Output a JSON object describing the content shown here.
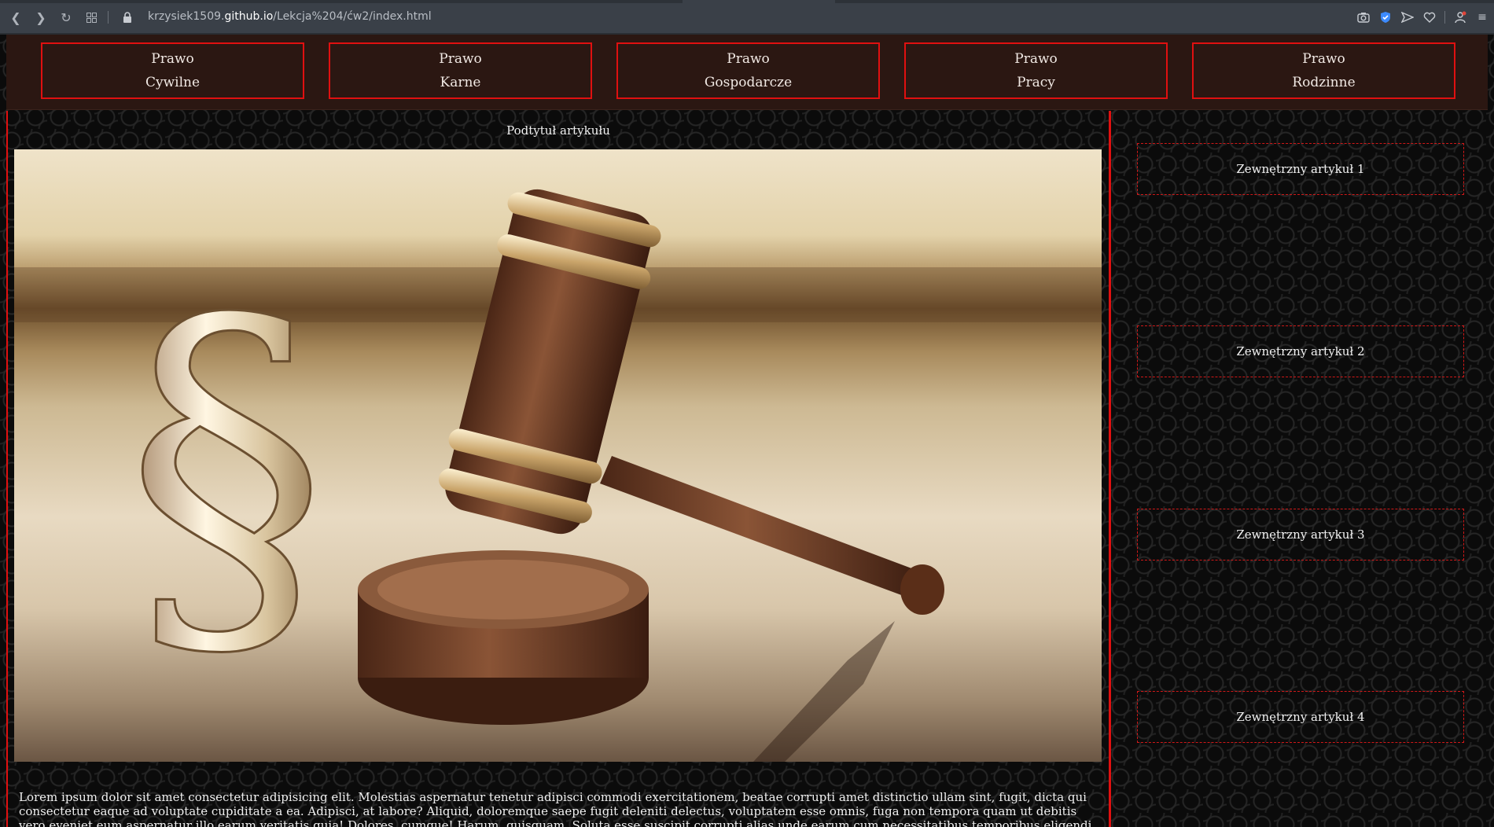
{
  "browser": {
    "url_prefix": "krzysiek1509.",
    "url_host": "github.io",
    "url_path": "/Lekcja%204/ćw2/index.html"
  },
  "nav": {
    "items": [
      {
        "line1": "Prawo",
        "line2": "Cywilne"
      },
      {
        "line1": "Prawo",
        "line2": "Karne"
      },
      {
        "line1": "Prawo",
        "line2": "Gospodarcze"
      },
      {
        "line1": "Prawo",
        "line2": "Pracy"
      },
      {
        "line1": "Prawo",
        "line2": "Rodzinne"
      }
    ]
  },
  "article": {
    "subtitle": "Podtytuł artykułu",
    "body": "Lorem ipsum dolor sit amet consectetur adipisicing elit. Molestias aspernatur tenetur adipisci commodi exercitationem, beatae corrupti amet distinctio ullam sint, fugit, dicta qui consectetur eaque ad voluptate cupiditate a ea. Adipisci, at labore? Aliquid, doloremque saepe fugit deleniti delectus, voluptatem esse omnis, fuga non tempora quam ut debitis vero eveniet eum aspernatur illo earum veritatis quia! Dolores, cumque! Harum, quisquam. Soluta esse suscipit corrupti alias unde earum cum necessitatibus temporibus eligendi nam similique perferendis, reprehenderit aliquam nostrum. Maiores inventore, fugiat molestiae nisi,"
  },
  "sidebar": {
    "links": [
      {
        "label": "Zewnętrzny artykuł 1"
      },
      {
        "label": "Zewnętrzny artykuł 2"
      },
      {
        "label": "Zewnętrzny artykuł 3"
      },
      {
        "label": "Zewnętrzny artykuł 4"
      }
    ]
  },
  "colors": {
    "accent_red": "#e01010",
    "nav_bg": "#2b1712",
    "page_bg": "#0b0b0b"
  }
}
